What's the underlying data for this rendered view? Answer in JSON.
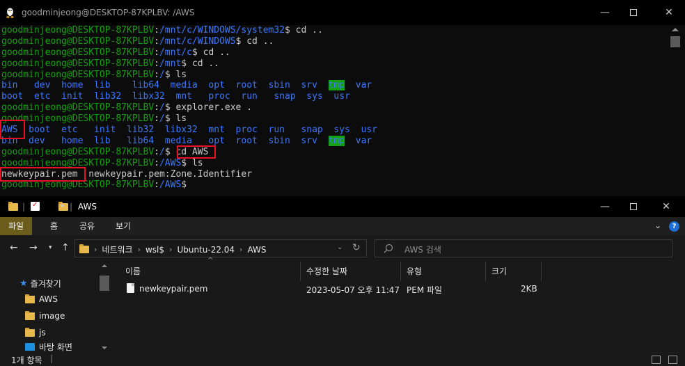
{
  "terminal": {
    "title": "goodminjeong@DESKTOP-87KPLBV: /AWS",
    "lines": [
      [
        {
          "t": "goodminjeong@DESKTOP-87KPLBV",
          "c": "g"
        },
        {
          "t": ":",
          "c": "w"
        },
        {
          "t": "/mnt/c/WINDOWS/system32",
          "c": "b"
        },
        {
          "t": "$ cd ..",
          "c": "w"
        }
      ],
      [
        {
          "t": "goodminjeong@DESKTOP-87KPLBV",
          "c": "g"
        },
        {
          "t": ":",
          "c": "w"
        },
        {
          "t": "/mnt/c/WINDOWS",
          "c": "b"
        },
        {
          "t": "$ cd ..",
          "c": "w"
        }
      ],
      [
        {
          "t": "goodminjeong@DESKTOP-87KPLBV",
          "c": "g"
        },
        {
          "t": ":",
          "c": "w"
        },
        {
          "t": "/mnt/c",
          "c": "b"
        },
        {
          "t": "$ cd ..",
          "c": "w"
        }
      ],
      [
        {
          "t": "goodminjeong@DESKTOP-87KPLBV",
          "c": "g"
        },
        {
          "t": ":",
          "c": "w"
        },
        {
          "t": "/mnt",
          "c": "b"
        },
        {
          "t": "$ cd ..",
          "c": "w"
        }
      ],
      [
        {
          "t": "goodminjeong@DESKTOP-87KPLBV",
          "c": "g"
        },
        {
          "t": ":",
          "c": "w"
        },
        {
          "t": "/",
          "c": "b"
        },
        {
          "t": "$ ls",
          "c": "w"
        }
      ],
      [
        {
          "t": "bin   dev  home  lib    lib64  media  opt  root  sbin  srv  ",
          "c": "b"
        },
        {
          "t": "tmp",
          "c": "hl"
        },
        {
          "t": "  var",
          "c": "b"
        }
      ],
      [
        {
          "t": "boot  etc  init  lib32  libx32  mnt   proc  run   snap  sys  usr",
          "c": "b"
        }
      ],
      [
        {
          "t": "goodminjeong@DESKTOP-87KPLBV",
          "c": "g"
        },
        {
          "t": ":",
          "c": "w"
        },
        {
          "t": "/",
          "c": "b"
        },
        {
          "t": "$ explorer.exe .",
          "c": "w"
        }
      ],
      [
        {
          "t": "goodminjeong@DESKTOP-87KPLBV",
          "c": "g"
        },
        {
          "t": ":",
          "c": "w"
        },
        {
          "t": "/",
          "c": "b"
        },
        {
          "t": "$ ls",
          "c": "w"
        }
      ],
      [
        {
          "t": "AWS  boot  etc   init  lib32  libx32  mnt  proc  run   snap  sys  usr",
          "c": "b"
        }
      ],
      [
        {
          "t": "bin  dev   home  lib   lib64  media   opt  root  sbin  srv  ",
          "c": "b"
        },
        {
          "t": "tmp",
          "c": "hl"
        },
        {
          "t": "  var",
          "c": "b"
        }
      ],
      [
        {
          "t": "goodminjeong@DESKTOP-87KPLBV",
          "c": "g"
        },
        {
          "t": ":",
          "c": "w"
        },
        {
          "t": "/",
          "c": "b"
        },
        {
          "t": "$ cd AWS",
          "c": "w"
        }
      ],
      [
        {
          "t": "goodminjeong@DESKTOP-87KPLBV",
          "c": "g"
        },
        {
          "t": ":",
          "c": "w"
        },
        {
          "t": "/AWS",
          "c": "b"
        },
        {
          "t": "$ ls",
          "c": "w"
        }
      ],
      [
        {
          "t": "newkeypair.pem  newkeypair.pem:Zone.Identifier",
          "c": "w"
        }
      ],
      [
        {
          "t": "goodminjeong@DESKTOP-87KPLBV",
          "c": "g"
        },
        {
          "t": ":",
          "c": "w"
        },
        {
          "t": "/AWS",
          "c": "b"
        },
        {
          "t": "$",
          "c": "w"
        }
      ]
    ]
  },
  "explorer": {
    "title": "AWS",
    "ribbon_tabs": [
      "파일",
      "홈",
      "공유",
      "보기"
    ],
    "help_label": "?",
    "breadcrumb": [
      "네트워크",
      "wsl$",
      "Ubuntu-22.04",
      "AWS"
    ],
    "search_placeholder": "AWS 검색",
    "nav": {
      "quick_access": "즐겨찾기",
      "items": [
        "AWS",
        "image",
        "js",
        "바탕 화면"
      ]
    },
    "columns": [
      "이름",
      "수정한 날짜",
      "유형",
      "크기"
    ],
    "files": [
      {
        "name": "newkeypair.pem",
        "modified": "2023-05-07 오후 11:47",
        "type": "PEM 파일",
        "size": "2KB"
      }
    ],
    "status": "1개 항목"
  },
  "colors": {
    "prompt_green": "#13a10e",
    "dir_blue": "#3b78ff",
    "highlight_red": "#e81123",
    "active_tab": "#6b5c1c"
  }
}
